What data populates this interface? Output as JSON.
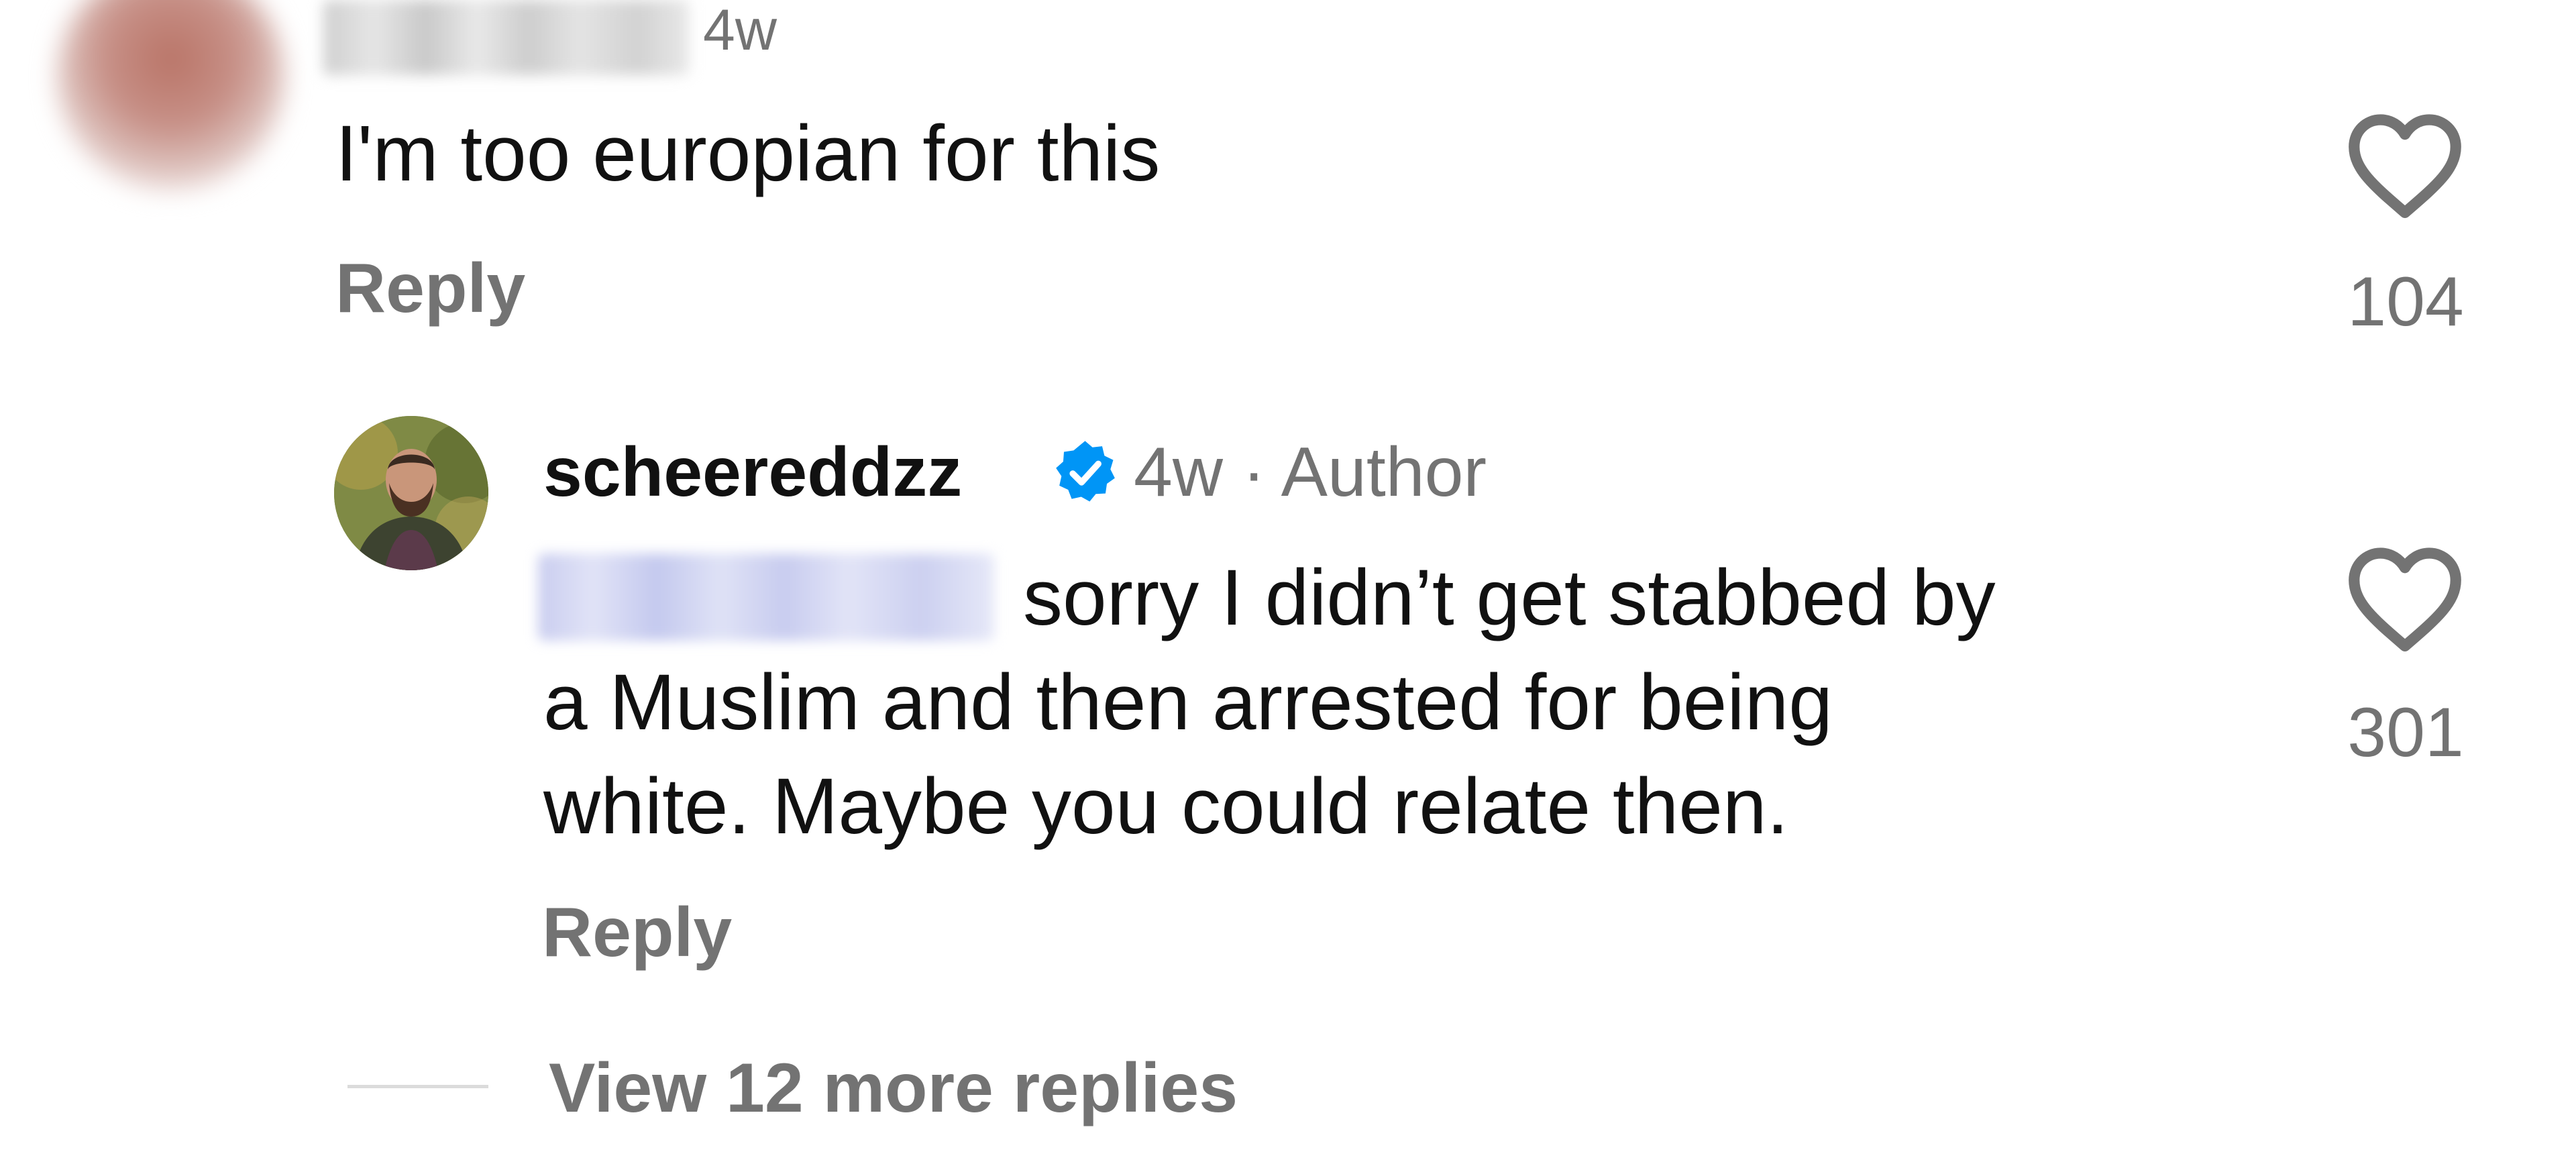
{
  "comments": [
    {
      "time": "4w",
      "text": "I'm too europian for this",
      "reply_label": "Reply",
      "likes": "104",
      "icons": {
        "like": "heart-outline-icon"
      }
    }
  ],
  "author_reply": {
    "username": "scheereddzz",
    "verified": true,
    "meta": "4w · Author",
    "text_lines": [
      "sorry I didn’t get stabbed by",
      "a Muslim and then arrested for being",
      "white. Maybe you could relate then."
    ],
    "reply_label": "Reply",
    "likes": "301",
    "icons": {
      "like": "heart-outline-icon",
      "badge": "verified-badge-icon"
    }
  },
  "view_more_replies": "View 12 more replies",
  "colors": {
    "text_primary": "#111111",
    "text_secondary": "#737373",
    "verified_blue": "#0095f6",
    "divider": "#dbdbdb"
  }
}
